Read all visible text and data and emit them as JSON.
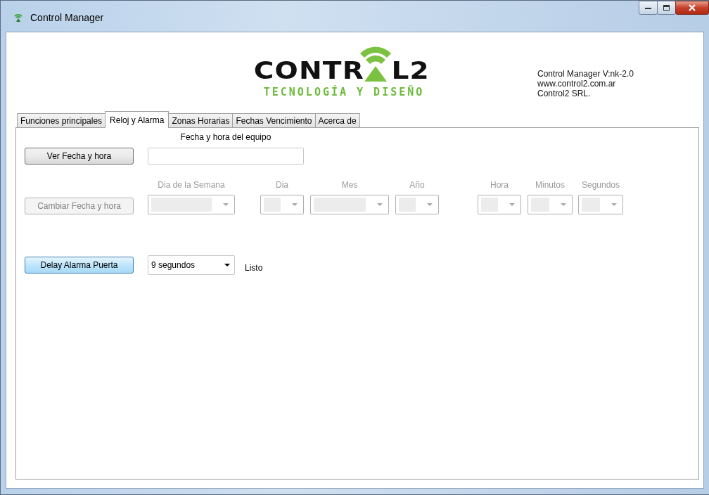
{
  "window": {
    "title": "Control Manager"
  },
  "logo": {
    "wordmark_left": "CONTR",
    "wordmark_right": "L2",
    "tagline": "TECNOLOGÍA Y DISEÑO"
  },
  "about_lines": [
    "Control Manager V:nk-2.0",
    "www.control2.com.ar",
    "Control2 SRL."
  ],
  "tabs": [
    {
      "label": "Funciones principales",
      "selected": false
    },
    {
      "label": "Reloj y Alarma",
      "selected": true
    },
    {
      "label": "Zonas Horarias",
      "selected": false
    },
    {
      "label": "Fechas Vencimiento",
      "selected": false
    },
    {
      "label": "Acerca de",
      "selected": false
    }
  ],
  "datetime": {
    "label": "Fecha y hora del equipo",
    "button": "Ver Fecha y hora"
  },
  "change": {
    "button": "Cambiar Fecha y hora",
    "disabled": true,
    "selectors": [
      {
        "label": "Dia de la Semana",
        "disabled": true
      },
      {
        "label": "Dia",
        "disabled": true
      },
      {
        "label": "Mes",
        "disabled": true
      },
      {
        "label": "Año",
        "disabled": true
      },
      {
        "label": "Hora",
        "disabled": true
      },
      {
        "label": "Minutos",
        "disabled": true
      },
      {
        "label": "Segundos",
        "disabled": true
      }
    ]
  },
  "delay": {
    "button": "Delay Alarma Puerta",
    "value": "9 segundos",
    "status": "Listo"
  }
}
